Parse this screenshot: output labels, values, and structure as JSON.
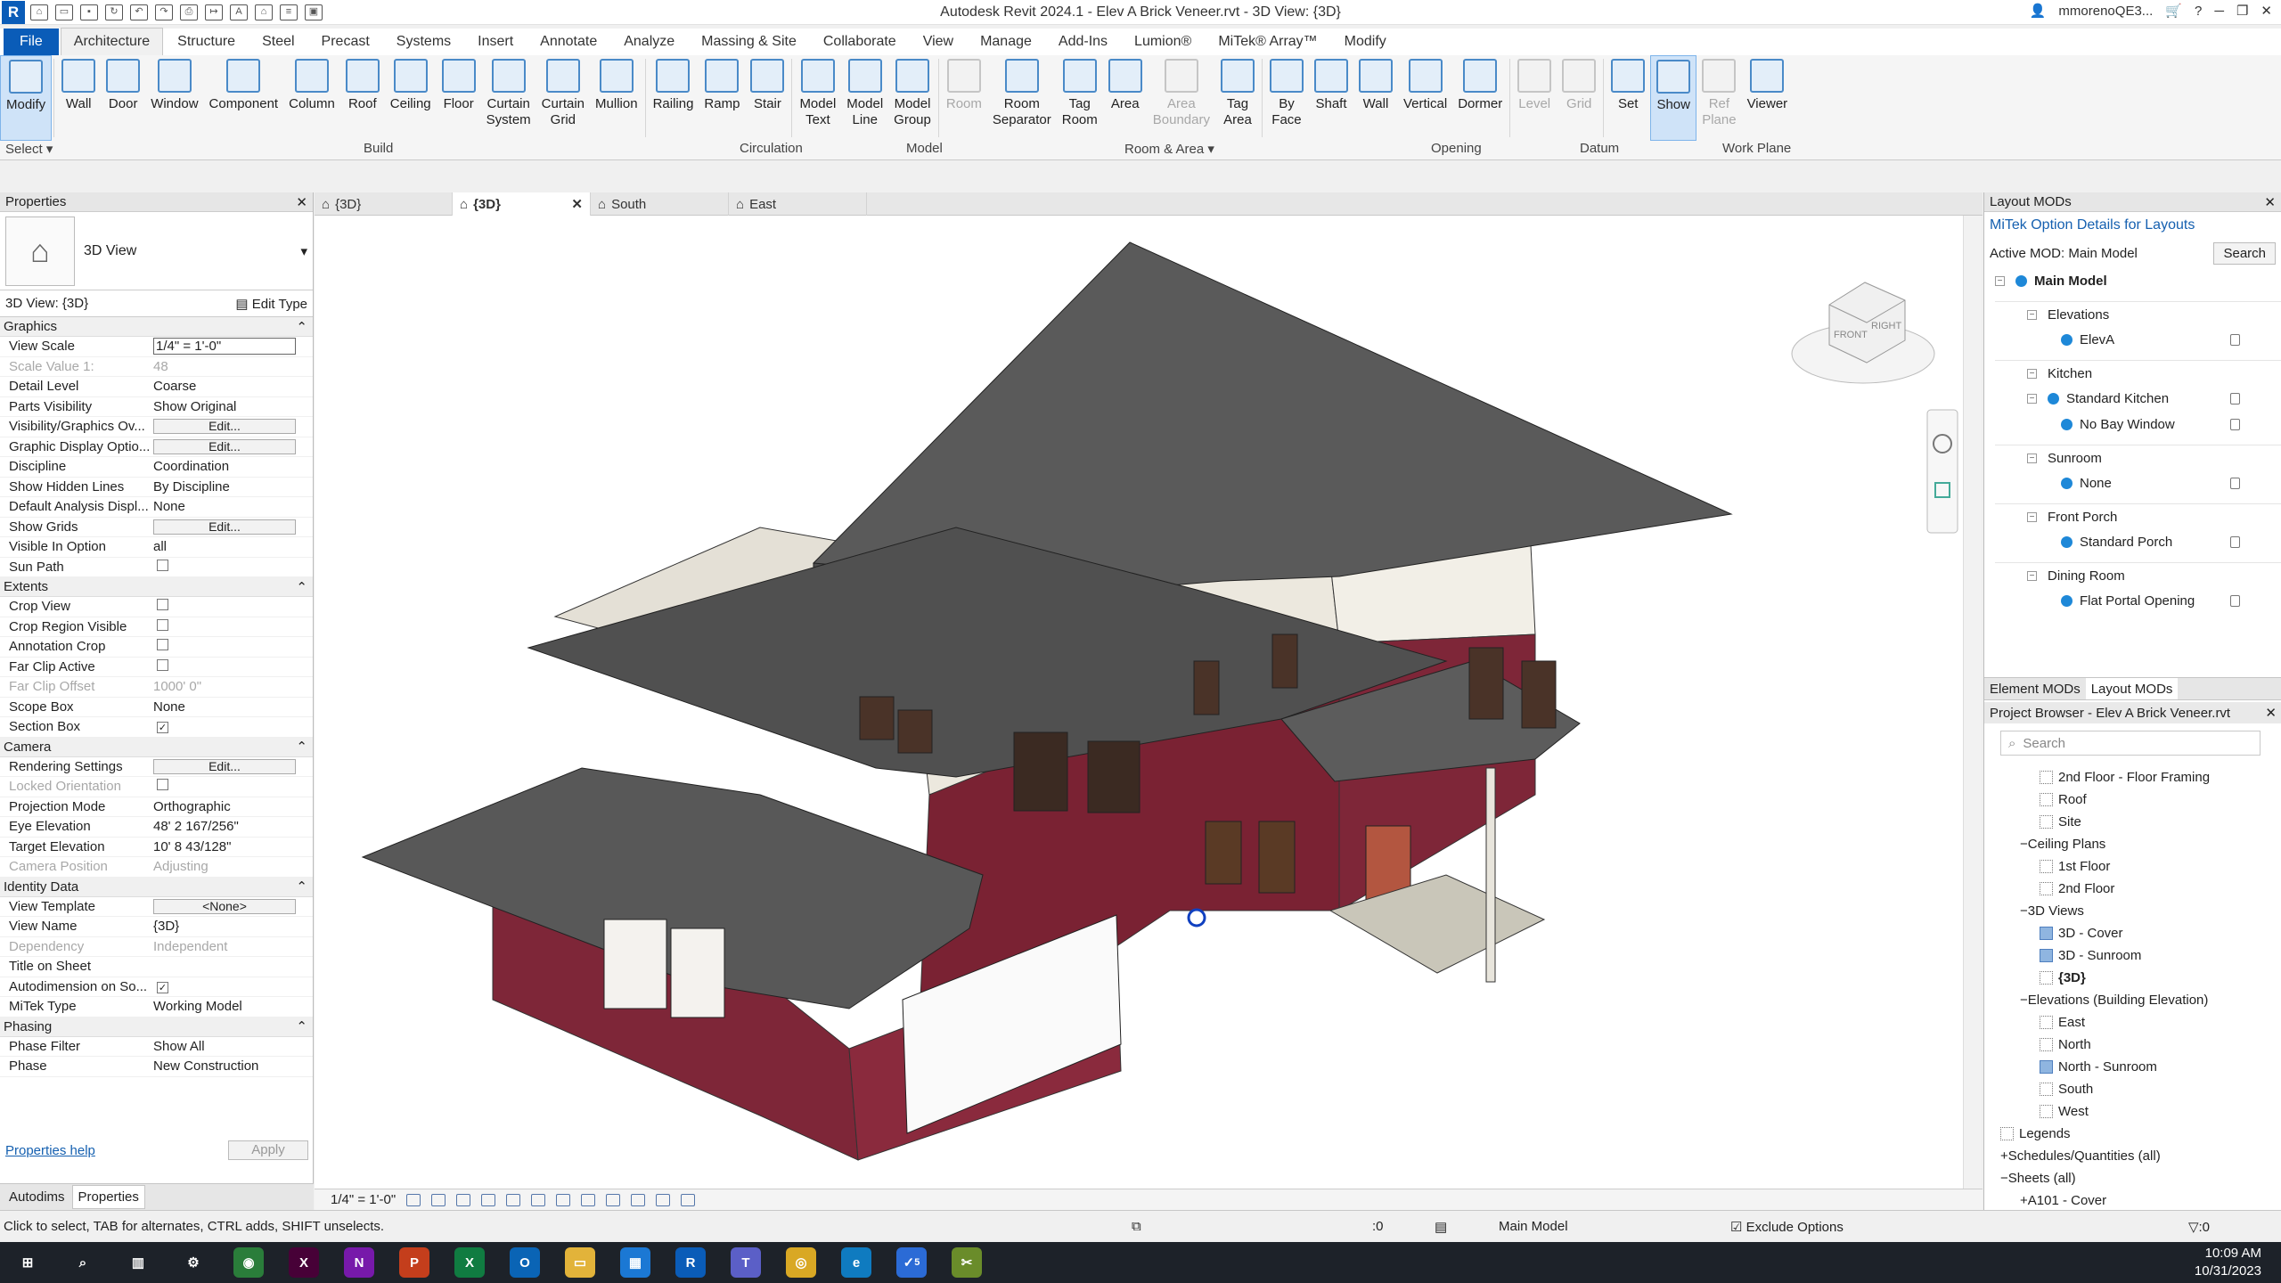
{
  "window": {
    "title": "Autodesk Revit 2024.1 - Elev A Brick Veneer.rvt - 3D View: {3D}",
    "user": "mmorenoQE3...",
    "app_letter": "R"
  },
  "menu_tabs": [
    "File",
    "Architecture",
    "Structure",
    "Steel",
    "Precast",
    "Systems",
    "Insert",
    "Annotate",
    "Analyze",
    "Massing & Site",
    "Collaborate",
    "View",
    "Manage",
    "Add-Ins",
    "Lumion®",
    "MiTek® Array™",
    "Modify"
  ],
  "ribbon": {
    "tools": [
      {
        "l1": "Modify",
        "l2": "",
        "sel": true
      },
      {
        "l1": "Wall",
        "l2": ""
      },
      {
        "l1": "Door",
        "l2": ""
      },
      {
        "l1": "Window",
        "l2": ""
      },
      {
        "l1": "Component",
        "l2": ""
      },
      {
        "l1": "Column",
        "l2": ""
      },
      {
        "l1": "Roof",
        "l2": ""
      },
      {
        "l1": "Ceiling",
        "l2": ""
      },
      {
        "l1": "Floor",
        "l2": ""
      },
      {
        "l1": "Curtain",
        "l2": "System"
      },
      {
        "l1": "Curtain",
        "l2": "Grid"
      },
      {
        "l1": "Mullion",
        "l2": ""
      },
      {
        "l1": "Railing",
        "l2": ""
      },
      {
        "l1": "Ramp",
        "l2": ""
      },
      {
        "l1": "Stair",
        "l2": ""
      },
      {
        "l1": "Model",
        "l2": "Text"
      },
      {
        "l1": "Model",
        "l2": "Line"
      },
      {
        "l1": "Model",
        "l2": "Group"
      },
      {
        "l1": "Room",
        "l2": "",
        "dis": true
      },
      {
        "l1": "Room",
        "l2": "Separator"
      },
      {
        "l1": "Tag",
        "l2": "Room"
      },
      {
        "l1": "Area",
        "l2": ""
      },
      {
        "l1": "Area",
        "l2": "Boundary",
        "dis": true
      },
      {
        "l1": "Tag",
        "l2": "Area"
      },
      {
        "l1": "By",
        "l2": "Face"
      },
      {
        "l1": "Shaft",
        "l2": ""
      },
      {
        "l1": "Wall",
        "l2": ""
      },
      {
        "l1": "Vertical",
        "l2": ""
      },
      {
        "l1": "Dormer",
        "l2": ""
      },
      {
        "l1": "Level",
        "l2": "",
        "dis": true
      },
      {
        "l1": "Grid",
        "l2": "",
        "dis": true
      },
      {
        "l1": "Set",
        "l2": ""
      },
      {
        "l1": "Show",
        "l2": "",
        "sel": true
      },
      {
        "l1": "Ref",
        "l2": "Plane",
        "dis": true
      },
      {
        "l1": "Viewer",
        "l2": ""
      }
    ],
    "panels": {
      "select": "Select ▾",
      "build": "Build",
      "circulation": "Circulation",
      "model": "Model",
      "room_area": "Room & Area ▾",
      "opening": "Opening",
      "datum": "Datum",
      "work_plane": "Work Plane"
    }
  },
  "properties": {
    "header": "Properties",
    "type_name": "3D View",
    "selector": "3D View: {3D}",
    "edit_type": "Edit Type",
    "groups": [
      {
        "name": "Graphics",
        "rows": [
          {
            "k": "View Scale",
            "v": "1/4\" = 1'-0\"",
            "t": "input"
          },
          {
            "k": "Scale Value    1:",
            "v": "48",
            "dim": true
          },
          {
            "k": "Detail Level",
            "v": "Coarse"
          },
          {
            "k": "Parts Visibility",
            "v": "Show Original"
          },
          {
            "k": "Visibility/Graphics Ov...",
            "v": "Edit...",
            "t": "btn"
          },
          {
            "k": "Graphic Display Optio...",
            "v": "Edit...",
            "t": "btn"
          },
          {
            "k": "Discipline",
            "v": "Coordination"
          },
          {
            "k": "Show Hidden Lines",
            "v": "By Discipline"
          },
          {
            "k": "Default Analysis Displ...",
            "v": "None"
          },
          {
            "k": "Show Grids",
            "v": "Edit...",
            "t": "btn"
          },
          {
            "k": "Visible In Option",
            "v": "all"
          },
          {
            "k": "Sun Path",
            "v": "",
            "t": "chk",
            "c": false
          }
        ]
      },
      {
        "name": "Extents",
        "rows": [
          {
            "k": "Crop View",
            "v": "",
            "t": "chk",
            "c": false
          },
          {
            "k": "Crop Region Visible",
            "v": "",
            "t": "chk",
            "c": false
          },
          {
            "k": "Annotation Crop",
            "v": "",
            "t": "chk",
            "c": false
          },
          {
            "k": "Far Clip Active",
            "v": "",
            "t": "chk",
            "c": false
          },
          {
            "k": "Far Clip Offset",
            "v": "1000'  0\"",
            "dim": true
          },
          {
            "k": "Scope Box",
            "v": "None"
          },
          {
            "k": "Section Box",
            "v": "",
            "t": "chk",
            "c": true
          }
        ]
      },
      {
        "name": "Camera",
        "rows": [
          {
            "k": "Rendering Settings",
            "v": "Edit...",
            "t": "btn"
          },
          {
            "k": "Locked Orientation",
            "v": "",
            "t": "chk",
            "c": false,
            "dim": true
          },
          {
            "k": "Projection Mode",
            "v": "Orthographic"
          },
          {
            "k": "Eye Elevation",
            "v": "48'  2 167/256\""
          },
          {
            "k": "Target Elevation",
            "v": "10'  8 43/128\""
          },
          {
            "k": "Camera Position",
            "v": "Adjusting",
            "dim": true
          }
        ]
      },
      {
        "name": "Identity Data",
        "rows": [
          {
            "k": "View Template",
            "v": "<None>",
            "t": "btn"
          },
          {
            "k": "View Name",
            "v": "{3D}"
          },
          {
            "k": "Dependency",
            "v": "Independent",
            "dim": true
          },
          {
            "k": "Title on Sheet",
            "v": ""
          },
          {
            "k": "Autodimension on So...",
            "v": "",
            "t": "chk",
            "c": true
          },
          {
            "k": "MiTek Type",
            "v": "Working Model"
          }
        ]
      },
      {
        "name": "Phasing",
        "rows": [
          {
            "k": "Phase Filter",
            "v": "Show All"
          },
          {
            "k": "Phase",
            "v": "New Construction"
          }
        ]
      }
    ],
    "help": "Properties help",
    "apply": "Apply",
    "tabs": [
      "Autodims",
      "Properties"
    ]
  },
  "view_tabs": [
    {
      "label": "{3D}"
    },
    {
      "label": "{3D}",
      "active": true
    },
    {
      "label": "South"
    },
    {
      "label": "East"
    }
  ],
  "viewcube": {
    "front": "FRONT",
    "right": "RIGHT"
  },
  "view_scale": "1/4\" = 1'-0\"",
  "layout_mods": {
    "header": "Layout MODs",
    "title": "MiTek Option Details for Layouts",
    "active": "Active MOD: Main Model",
    "search": "Search",
    "root": "Main Model",
    "groups": [
      {
        "name": "Elevations",
        "items": [
          {
            "label": "ElevA",
            "lvl": 1
          }
        ]
      },
      {
        "name": "Kitchen",
        "items": [
          {
            "label": "Standard Kitchen",
            "lvl": 1,
            "tog": true
          },
          {
            "label": "No Bay Window",
            "lvl": 2
          }
        ]
      },
      {
        "name": "Sunroom",
        "items": [
          {
            "label": "None",
            "lvl": 1
          }
        ]
      },
      {
        "name": "Front Porch",
        "items": [
          {
            "label": "Standard Porch",
            "lvl": 1
          }
        ]
      },
      {
        "name": "Dining Room",
        "items": [
          {
            "label": "Flat Portal Opening",
            "lvl": 1
          }
        ]
      }
    ],
    "tabs": [
      "Element MODs",
      "Layout MODs"
    ]
  },
  "project_browser": {
    "header": "Project Browser - Elev A Brick Veneer.rvt",
    "search": "Search",
    "items": [
      {
        "label": "2nd Floor - Floor Framing",
        "lvl": 2,
        "icon": "sq"
      },
      {
        "label": "Roof",
        "lvl": 2,
        "icon": "sq"
      },
      {
        "label": "Site",
        "lvl": 2,
        "icon": "sq"
      },
      {
        "label": "Ceiling Plans",
        "lvl": 1,
        "icon": "minus"
      },
      {
        "label": "1st Floor",
        "lvl": 2,
        "icon": "sq"
      },
      {
        "label": "2nd Floor",
        "lvl": 2,
        "icon": "sq"
      },
      {
        "label": "3D Views",
        "lvl": 1,
        "icon": "minus"
      },
      {
        "label": "3D - Cover",
        "lvl": 2,
        "icon": "sel"
      },
      {
        "label": "3D - Sunroom",
        "lvl": 2,
        "icon": "sel"
      },
      {
        "label": "{3D}",
        "lvl": 2,
        "icon": "sq",
        "bold": true
      },
      {
        "label": "Elevations (Building Elevation)",
        "lvl": 1,
        "icon": "minus"
      },
      {
        "label": "East",
        "lvl": 2,
        "icon": "sq"
      },
      {
        "label": "North",
        "lvl": 2,
        "icon": "sq"
      },
      {
        "label": "North - Sunroom",
        "lvl": 2,
        "icon": "sel"
      },
      {
        "label": "South",
        "lvl": 2,
        "icon": "sq"
      },
      {
        "label": "West",
        "lvl": 2,
        "icon": "sq"
      },
      {
        "label": "Legends",
        "lvl": 0,
        "icon": "sq"
      },
      {
        "label": "Schedules/Quantities (all)",
        "lvl": 0,
        "icon": "plus"
      },
      {
        "label": "Sheets (all)",
        "lvl": 0,
        "icon": "minus"
      },
      {
        "label": "A101 - Cover",
        "lvl": 1,
        "icon": "plus"
      }
    ]
  },
  "status": {
    "hint": "Click to select, TAB for alternates, CTRL adds, SHIFT unselects.",
    "zero1": ":0",
    "model": "Main Model",
    "exclude": "Exclude Options",
    "zero2": ":0"
  },
  "taskbar": {
    "time": "10:09 AM",
    "date": "10/31/2023",
    "badge": "5"
  }
}
